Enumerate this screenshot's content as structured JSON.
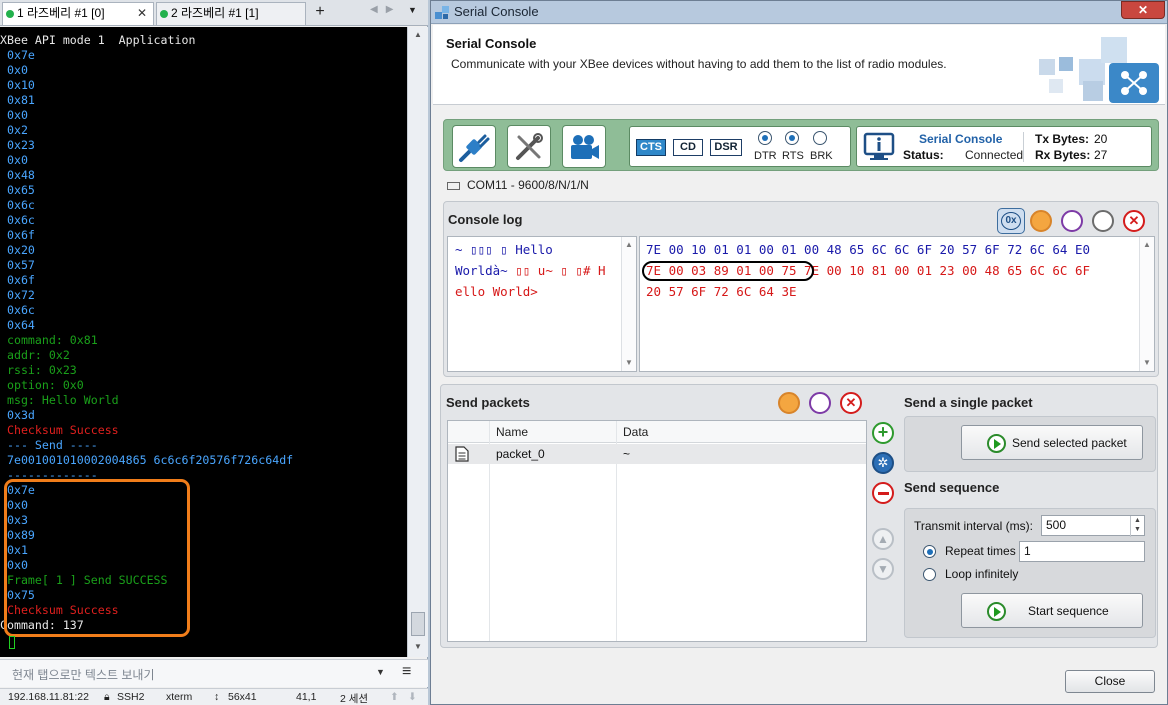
{
  "terminal": {
    "tabs": [
      {
        "label": "1 라즈베리 #1 [0]",
        "close": "✕"
      },
      {
        "label": "2 라즈베리 #1 [1]",
        "close": ""
      }
    ],
    "add_tab": "+",
    "lines": [
      {
        "text": "XBee API mode 1  Application",
        "color": "white"
      },
      {
        "text": " 0x7e",
        "color": "blue"
      },
      {
        "text": " 0x0",
        "color": "blue"
      },
      {
        "text": " 0x10",
        "color": "blue"
      },
      {
        "text": " 0x81",
        "color": "blue"
      },
      {
        "text": " 0x0",
        "color": "blue"
      },
      {
        "text": " 0x2",
        "color": "blue"
      },
      {
        "text": " 0x23",
        "color": "blue"
      },
      {
        "text": " 0x0",
        "color": "blue"
      },
      {
        "text": " 0x48",
        "color": "blue"
      },
      {
        "text": " 0x65",
        "color": "blue"
      },
      {
        "text": " 0x6c",
        "color": "blue"
      },
      {
        "text": " 0x6c",
        "color": "blue"
      },
      {
        "text": " 0x6f",
        "color": "blue"
      },
      {
        "text": " 0x20",
        "color": "blue"
      },
      {
        "text": " 0x57",
        "color": "blue"
      },
      {
        "text": " 0x6f",
        "color": "blue"
      },
      {
        "text": " 0x72",
        "color": "blue"
      },
      {
        "text": " 0x6c",
        "color": "blue"
      },
      {
        "text": " 0x64",
        "color": "blue"
      },
      {
        "text": " command: 0x81",
        "color": "green"
      },
      {
        "text": " addr: 0x2",
        "color": "green"
      },
      {
        "text": " rssi: 0x23",
        "color": "green"
      },
      {
        "text": " option: 0x0",
        "color": "green"
      },
      {
        "text": " msg: Hello World",
        "color": "green"
      },
      {
        "text": " 0x3d",
        "color": "blue"
      },
      {
        "text": " Checksum Success",
        "color": "red"
      },
      {
        "text": " --- Send ----",
        "color": "blue"
      },
      {
        "text": " 7e001001010002004865 6c6c6f20576f726c64df",
        "color": "blue"
      },
      {
        "text": " -------------",
        "color": "blue"
      },
      {
        "text": " 0x7e",
        "color": "blue"
      },
      {
        "text": " 0x0",
        "color": "blue"
      },
      {
        "text": " 0x3",
        "color": "blue"
      },
      {
        "text": " 0x89",
        "color": "blue"
      },
      {
        "text": " 0x1",
        "color": "blue"
      },
      {
        "text": " 0x0",
        "color": "blue"
      },
      {
        "text": " Frame[ 1 ] Send SUCCESS",
        "color": "green"
      },
      {
        "text": " 0x75",
        "color": "blue"
      },
      {
        "text": " Checksum Success",
        "color": "red"
      },
      {
        "text": "Command: 137",
        "color": "white"
      }
    ],
    "send_placeholder": "현재 탭으로만 텍스트 보내기",
    "status": {
      "host": "192.168.11.81:22",
      "proto": "SSH2",
      "term": "xterm",
      "size": "56x41",
      "pos": "41,1",
      "sessions": "2 세션"
    }
  },
  "serial_console": {
    "window_title": "Serial Console",
    "header_title": "Serial Console",
    "header_desc": "Communicate with your XBee devices without having to add them to the list of radio modules.",
    "lines": [
      "CTS",
      "CD",
      "DSR"
    ],
    "radios": [
      {
        "label": "DTR",
        "checked": true
      },
      {
        "label": "RTS",
        "checked": true
      },
      {
        "label": "BRK",
        "checked": false
      }
    ],
    "status_name": "Serial Console",
    "status_label": "Status:",
    "status_value": "Connected",
    "tx_label": "Tx Bytes:",
    "tx_value": "20",
    "rx_label": "Rx Bytes:",
    "rx_value": "27",
    "port": "COM11 - 9600/8/N/1/N",
    "console_log_title": "Console log",
    "hex_toggle": "0x",
    "ascii_lines": [
      {
        "text": "~ ▯▯▯ ▯ Hello",
        "color": "blue"
      },
      {
        "text": "Worldà~ ▯▯ u~ ▯ ▯# H",
        "color": "mixed"
      },
      {
        "text": "ello World>",
        "color": "red"
      }
    ],
    "ascii_line2_blue": "Worldà~ ",
    "ascii_line2_red": "▯▯ u~ ▯ ▯# H",
    "hex_line1": "7E 00 10 01 01 00 01 00 48 65 6C 6C 6F 20 57 6F 72 6C 64 E0",
    "hex_line2_circled": "7E 00 03 89 01 00 75",
    "hex_line2_rest": " 7E 00 10 81 00 01 23 00 48 65 6C 6C 6F",
    "hex_line3": "20 57 6F 72 6C 64 3E",
    "send_packets_title": "Send packets",
    "columns": [
      "Name",
      "Data"
    ],
    "packets": [
      {
        "name": "packet_0",
        "data": "~"
      }
    ],
    "single_title": "Send a single packet",
    "send_selected": "Send selected packet",
    "seq_title": "Send sequence",
    "interval_label": "Transmit interval (ms):",
    "interval_value": "500",
    "repeat_label": "Repeat times",
    "repeat_value": "1",
    "loop_label": "Loop infinitely",
    "start_seq": "Start sequence",
    "close": "Close"
  }
}
